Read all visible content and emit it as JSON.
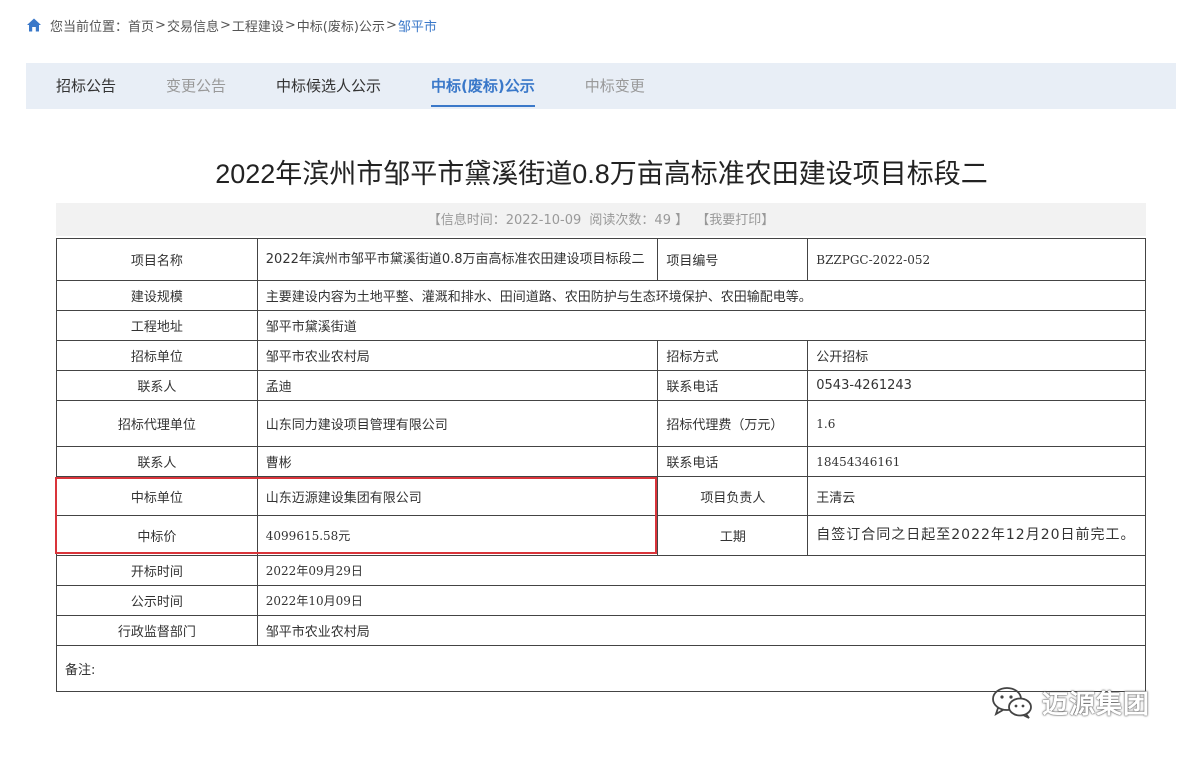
{
  "breadcrumb": {
    "prefix": "您当前位置：",
    "items": [
      "首页",
      "交易信息",
      "工程建设",
      "中标(废标)公示",
      "邹平市"
    ],
    "sep": ">"
  },
  "tabs": [
    {
      "label": "招标公告",
      "state": "normal"
    },
    {
      "label": "变更公告",
      "state": "dim"
    },
    {
      "label": "中标候选人公示",
      "state": "normal"
    },
    {
      "label": "中标(废标)公示",
      "state": "active"
    },
    {
      "label": "中标变更",
      "state": "dim"
    }
  ],
  "title": "2022年滨州市邹平市黛溪街道0.8万亩高标准农田建设项目标段二",
  "infobar": {
    "info_time": "【信息时间：2022-10-09",
    "read_count": "阅读次数：49 】",
    "print": "【我要打印】"
  },
  "table": {
    "project_name_label": "项目名称",
    "project_name": "2022年滨州市邹平市黛溪街道0.8万亩高标准农田建设项目标段二",
    "project_no_label": "项目编号",
    "project_no": "BZZPGC-2022-052",
    "scale_label": "建设规模",
    "scale": "主要建设内容为土地平整、灌溉和排水、田间道路、农田防护与生态环境保护、农田输配电等。",
    "address_label": "工程地址",
    "address": "邹平市黛溪街道",
    "tender_unit_label": "招标单位",
    "tender_unit": "邹平市农业农村局",
    "tender_method_label": "招标方式",
    "tender_method": "公开招标",
    "contact1_label": "联系人",
    "contact1": "孟迪",
    "phone1_label": "联系电话",
    "phone1": "0543-4261243",
    "agent_label": "招标代理单位",
    "agent": "山东同力建设项目管理有限公司",
    "agent_fee_label": "招标代理费（万元）",
    "agent_fee": "1.6",
    "contact2_label": "联系人",
    "contact2": "曹彬",
    "phone2_label": "联系电话",
    "phone2": "18454346161",
    "winner_label": "中标单位",
    "winner": "山东迈源建设集团有限公司",
    "pm_label": "项目负责人",
    "pm": "王清云",
    "price_label": "中标价",
    "price": "4099615.58元",
    "period_label": "工期",
    "period": "自签订合同之日起至2022年12月20日前完工。",
    "open_time_label": "开标时间",
    "open_time": "2022年09月29日",
    "notice_time_label": "公示时间",
    "notice_time": "2022年10月09日",
    "supervisor_label": "行政监督部门",
    "supervisor": "邹平市农业农村局",
    "remark_label": "备注:"
  },
  "watermark": {
    "text": "迈源集团",
    "icon": "wechat-icon"
  },
  "colors": {
    "accent": "#3a78c9",
    "tabbar_bg": "#e8eef6",
    "highlight_border": "#d9343a"
  }
}
